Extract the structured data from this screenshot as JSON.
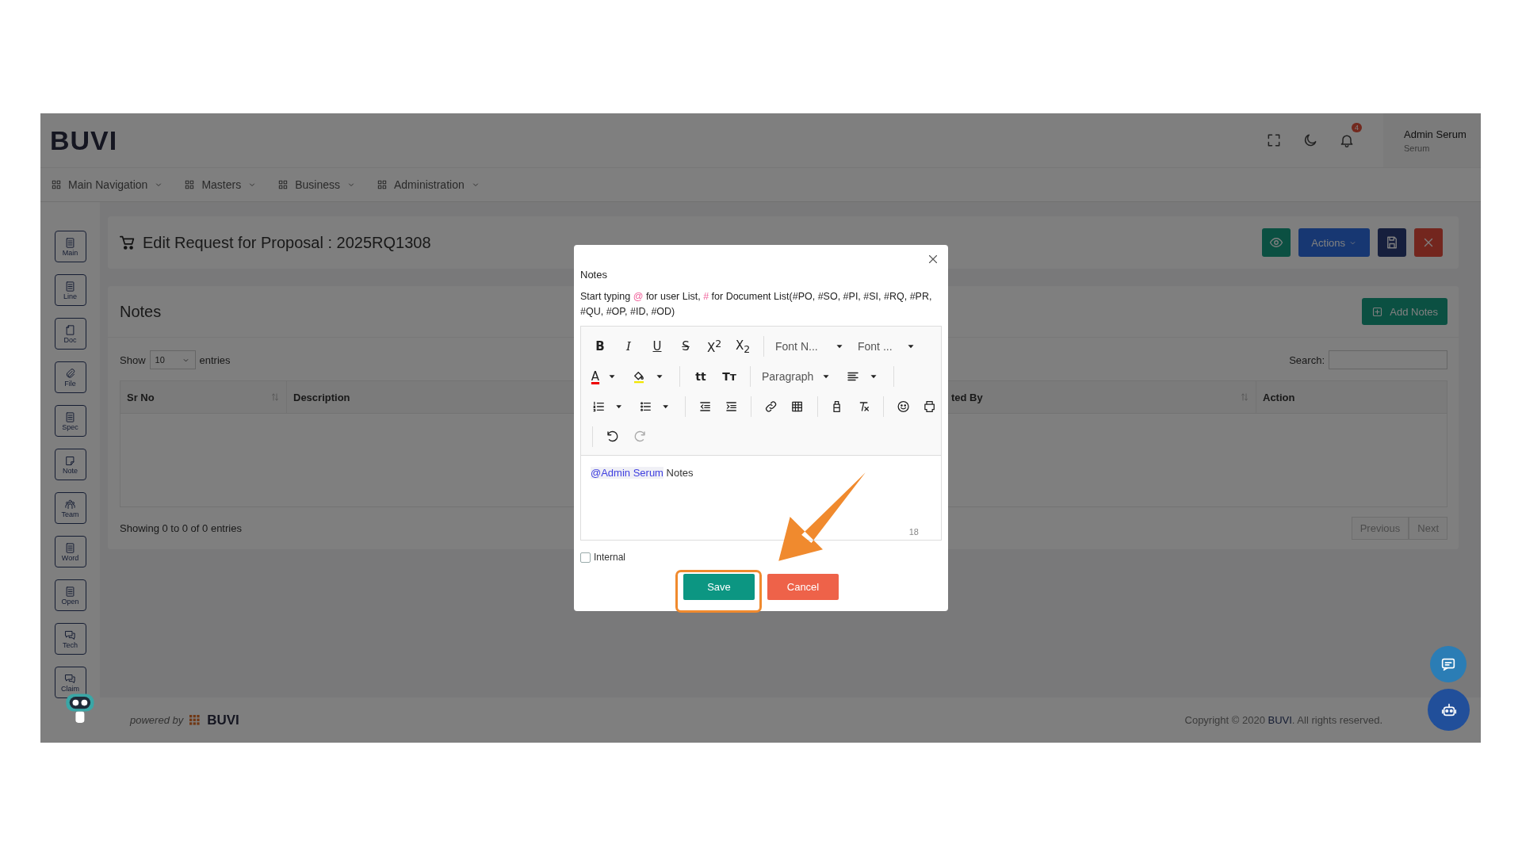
{
  "header": {
    "logo": "BUVI",
    "notification_count": "4",
    "user": {
      "name": "Admin Serum",
      "role": "Serum"
    }
  },
  "nav": [
    {
      "label": "Main Navigation"
    },
    {
      "label": "Masters"
    },
    {
      "label": "Business"
    },
    {
      "label": "Administration"
    }
  ],
  "sidebar": [
    {
      "label": "Main"
    },
    {
      "label": "Line"
    },
    {
      "label": "Doc"
    },
    {
      "label": "File"
    },
    {
      "label": "Spec"
    },
    {
      "label": "Note"
    },
    {
      "label": "Team"
    },
    {
      "label": "Word"
    },
    {
      "label": "Open"
    },
    {
      "label": "Tech"
    },
    {
      "label": "Claim"
    }
  ],
  "page": {
    "title": "Edit Request for Proposal : 2025RQ1308",
    "actions_label": "Actions"
  },
  "notes_card": {
    "title": "Notes",
    "add_label": "Add Notes",
    "show_label": "Show",
    "page_size": "10",
    "entries_label": "entries",
    "search_label": "Search:",
    "columns": [
      "Sr No",
      "Description",
      "ted By",
      "Action"
    ],
    "info": "Showing 0 to 0 of 0 entries",
    "pager": [
      {
        "label": "Previous",
        "disabled": true
      },
      {
        "label": "Next",
        "disabled": true
      }
    ]
  },
  "modal": {
    "title": "Notes",
    "hint": {
      "before": "Start typing ",
      "mark_1": "@",
      "middle": " for user List, ",
      "mark_2": "#",
      "after": " for Document List(#PO, #SO, #PI, #SI, #RQ, #PR, #QU, #OP, #ID, #OD)"
    },
    "toolbar": {
      "glyphs": [
        "B",
        "I",
        "U",
        "S",
        "X$^{2}$",
        "X$_{2}$",
        "A",
        "tt",
        "Tт"
      ],
      "font_name": "Font N...",
      "font_size": "Font ...",
      "block": "Paragraph"
    },
    "content": {
      "mention": "@Admin Serum",
      "text": "Notes"
    },
    "counter": "18",
    "internal": {
      "label": "Internal",
      "checked": false
    },
    "save": "Save",
    "cancel": "Cancel"
  },
  "footer": {
    "powered_by": "powered by",
    "brand": "BUVI",
    "copyright": "Copyright © 2020 **BUVI**. All rights reserved."
  }
}
